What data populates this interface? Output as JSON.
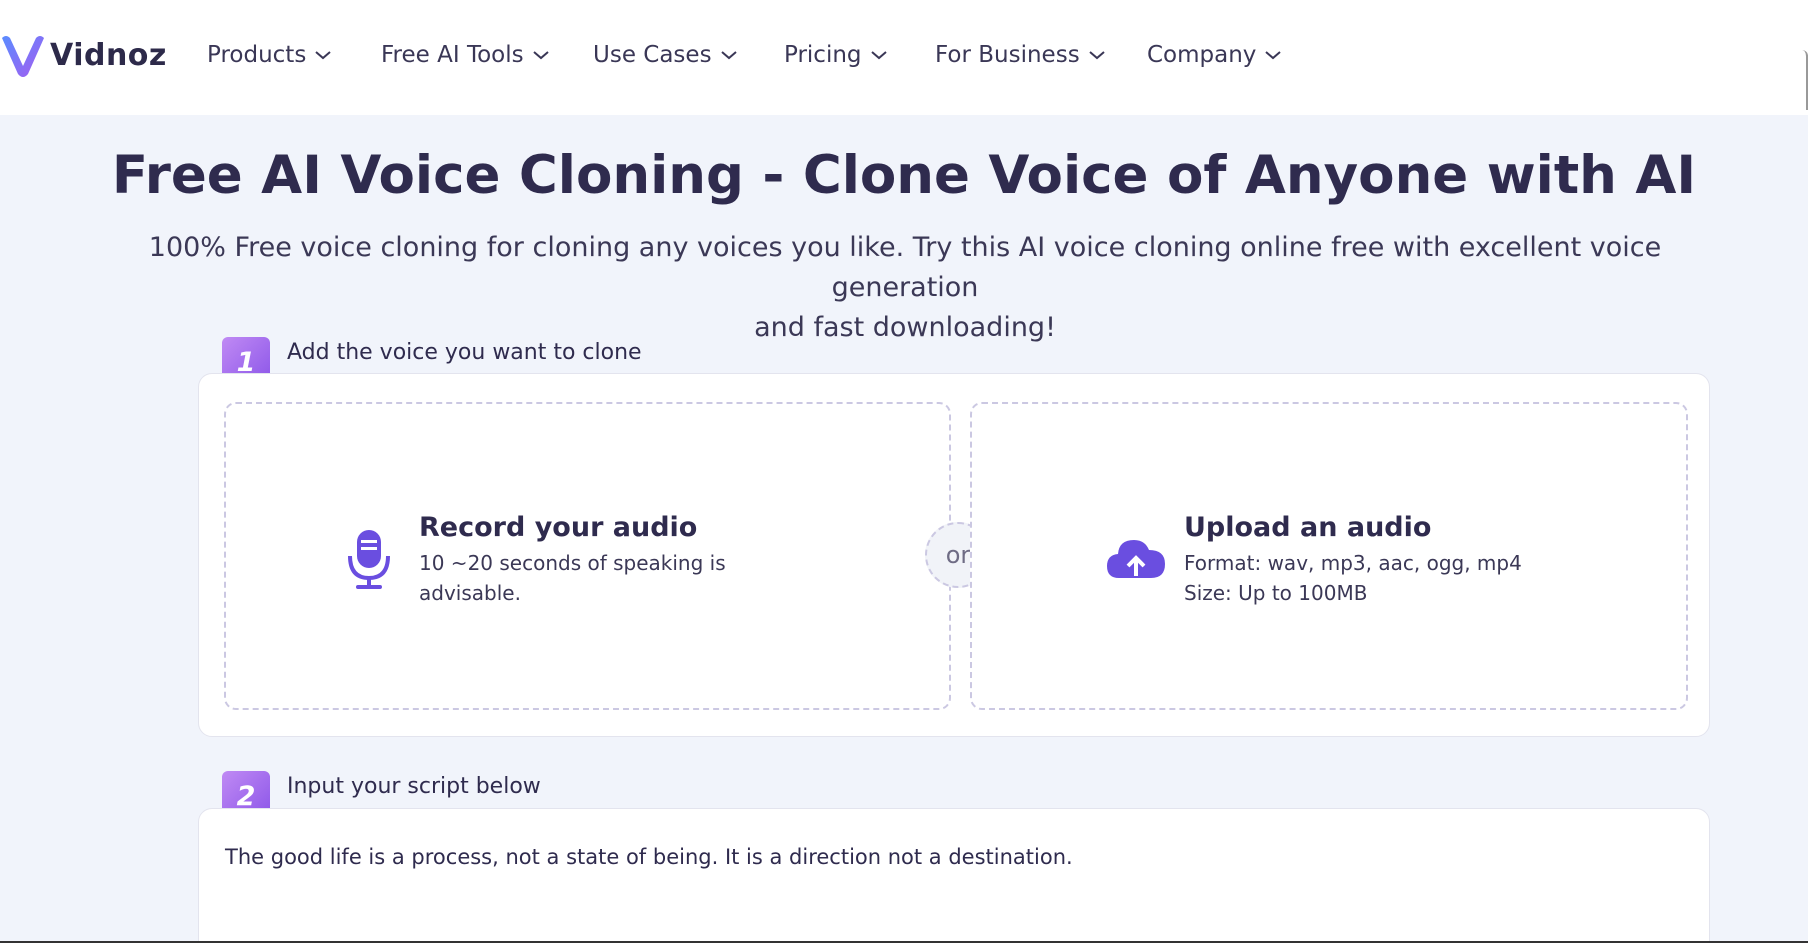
{
  "brand": {
    "name": "Vidnoz"
  },
  "nav": {
    "items": [
      {
        "label": "Products"
      },
      {
        "label": "Free AI Tools"
      },
      {
        "label": "Use Cases"
      },
      {
        "label": "Pricing"
      },
      {
        "label": "For Business"
      },
      {
        "label": "Company"
      }
    ]
  },
  "hero": {
    "title": "Free AI Voice Cloning - Clone Voice of Anyone with AI",
    "subtitle_line1": "100% Free voice cloning for cloning any voices you like. Try this AI voice cloning online free with excellent voice generation",
    "subtitle_line2": "and fast downloading!"
  },
  "step1": {
    "number": "1",
    "label": "Add the voice you want to clone",
    "record": {
      "icon": "microphone-icon",
      "title": "Record your audio",
      "desc_line1": "10 ~20 seconds of speaking is",
      "desc_line2": "advisable."
    },
    "or_label": "or",
    "upload": {
      "icon": "cloud-upload-icon",
      "title": "Upload an audio",
      "format": "Format: wav, mp3, aac, ogg, mp4",
      "size": "Size: Up to 100MB"
    }
  },
  "step2": {
    "number": "2",
    "label": "Input your script below",
    "script_text": "The good life is a process, not a state of being. It is a direction not a destination."
  },
  "colors": {
    "accent_purple": "#8a54e8",
    "icon_purple": "#6a4ee0",
    "text_dark": "#2f2b4e",
    "page_bg": "#f1f4fb"
  }
}
